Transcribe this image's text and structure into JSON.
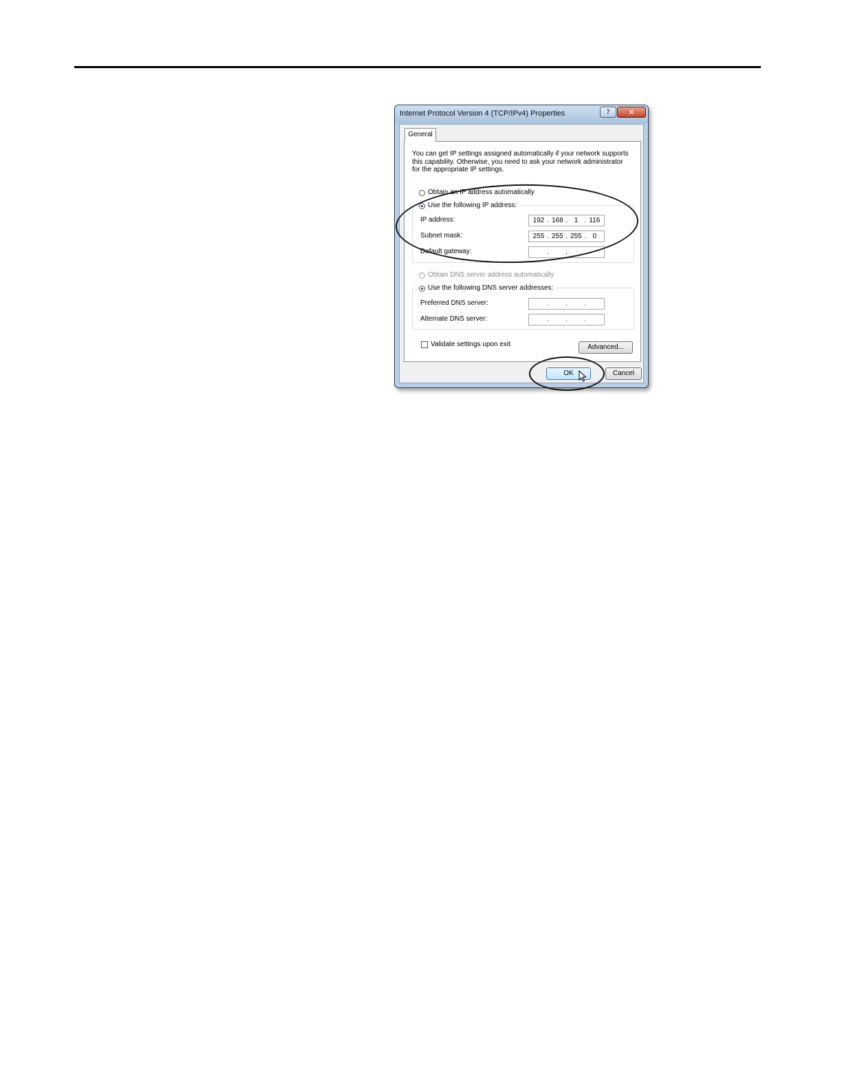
{
  "dialog": {
    "title": "Internet Protocol Version 4 (TCP/IPv4) Properties",
    "help_label": "?",
    "close_label": "✕",
    "tab_general": "General",
    "intro": "You can get IP settings assigned automatically if your network supports this capability. Otherwise, you need to ask your network administrator for the appropriate IP settings.",
    "ip_mode": {
      "auto_label": "Obtain an IP address automatically",
      "manual_label": "Use the following IP address:",
      "selected": "manual"
    },
    "ip_fields": {
      "ip_label": "IP address:",
      "ip_value": [
        "192",
        "168",
        "1",
        "116"
      ],
      "subnet_label": "Subnet mask:",
      "subnet_value": [
        "255",
        "255",
        "255",
        "0"
      ],
      "gateway_label": "Default gateway:",
      "gateway_value": [
        "",
        "",
        "",
        ""
      ]
    },
    "dns_mode": {
      "auto_label": "Obtain DNS server address automatically",
      "manual_label": "Use the following DNS server addresses:",
      "selected": "manual"
    },
    "dns_fields": {
      "preferred_label": "Preferred DNS server:",
      "alternate_label": "Alternate DNS server:"
    },
    "validate_label": "Validate settings upon exit",
    "validate_checked": false,
    "advanced_label": "Advanced...",
    "ok_label": "OK",
    "cancel_label": "Cancel"
  },
  "icons": {
    "cursor": "mouse-pointer-icon"
  }
}
